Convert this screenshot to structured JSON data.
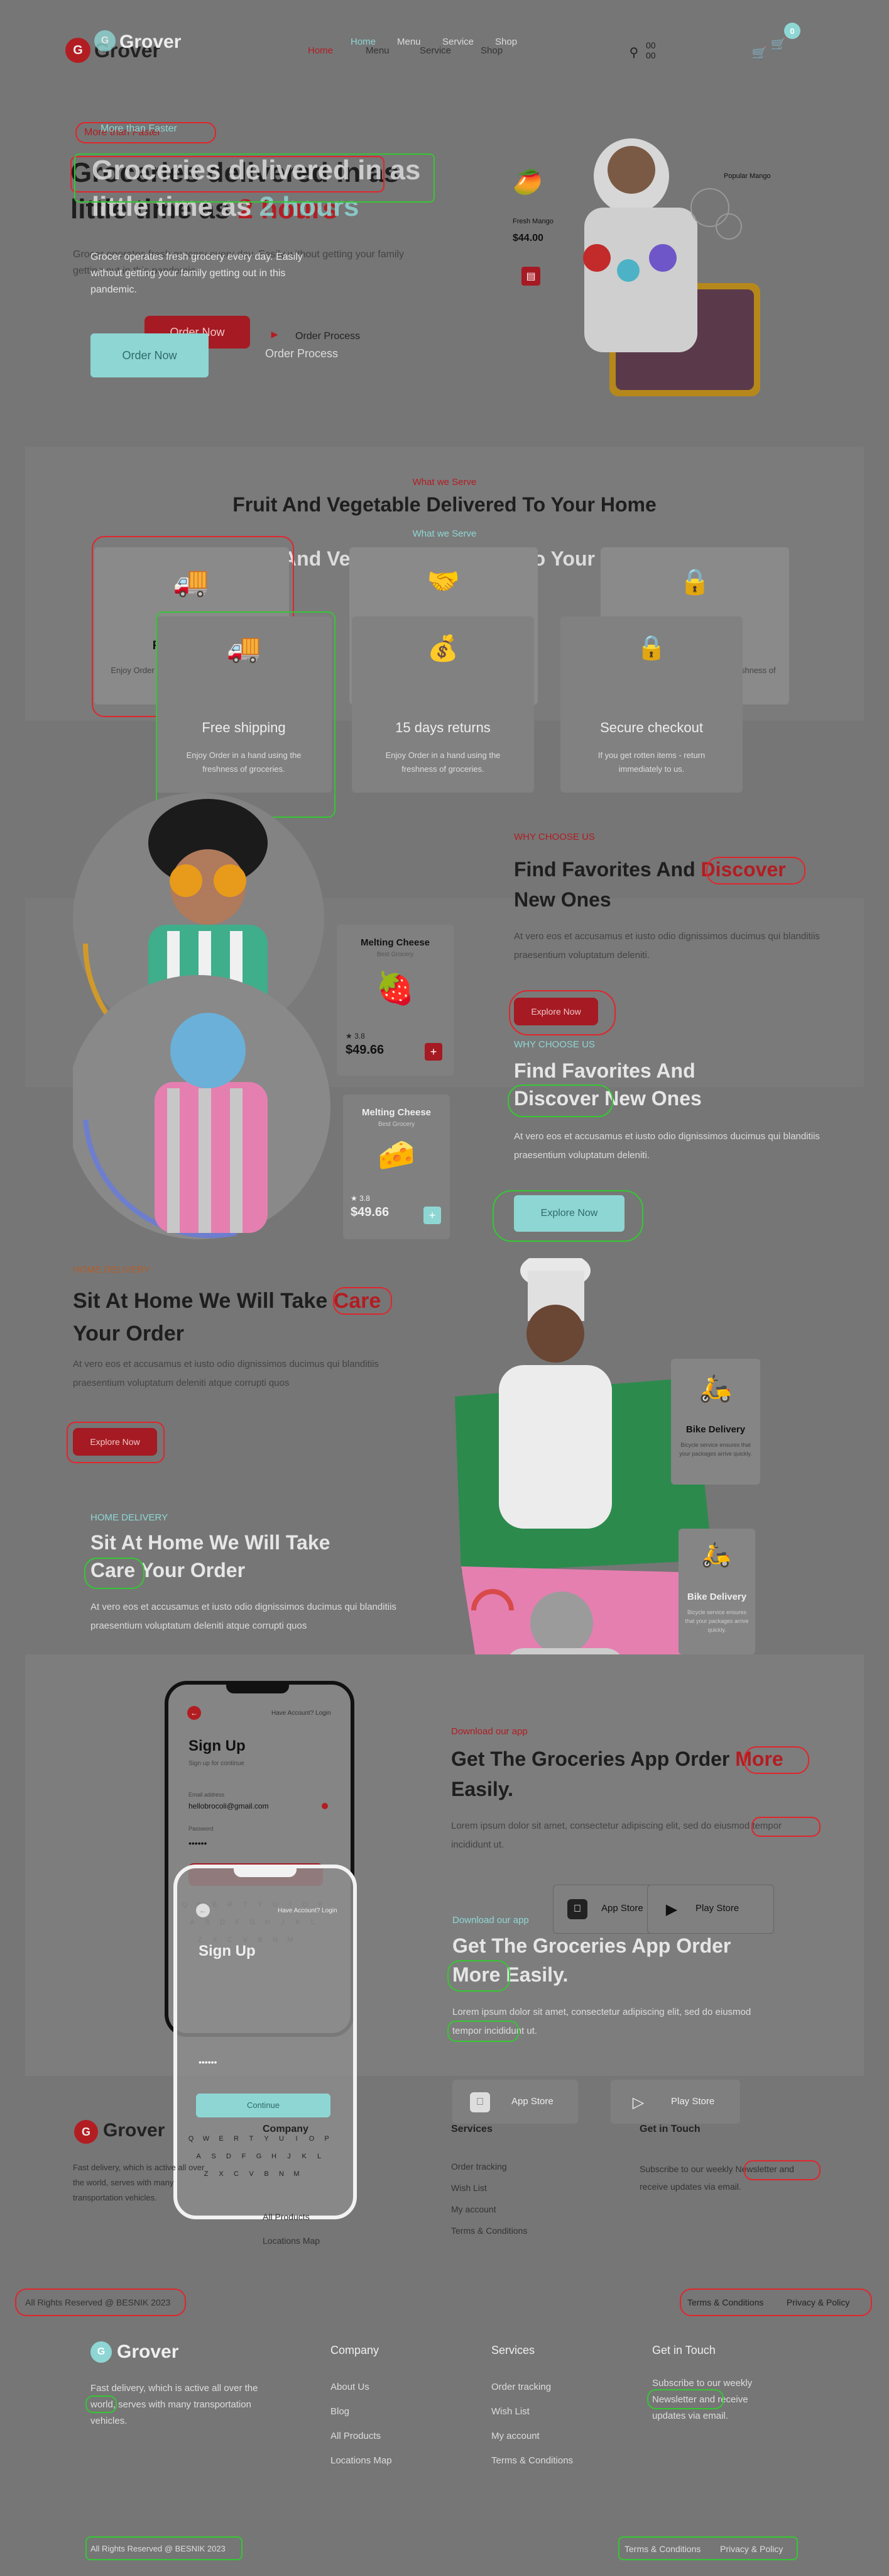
{
  "colors": {
    "red": "#b21d22",
    "teal": "#8ed6d3",
    "bg": "#767676"
  },
  "brand": {
    "name": "Grover",
    "icon": "g-letter-logo"
  },
  "nav": {
    "items": [
      "Home",
      "Menu",
      "Service",
      "Shop"
    ],
    "cart_count": "00",
    "search_count": "00",
    "badge": "0"
  },
  "hero": {
    "badge": "More than Faster",
    "title_line1": "Groceries delivered in as",
    "title_line2": "little time as",
    "title_hl": "2 hours",
    "desc": "Grocer operates fresh grocery every day. Easily without getting your family getting out in this pandemic.",
    "order_btn": "Order Now",
    "order_process": "Order Process",
    "product_name": "Fresh Mango",
    "product_price": "$44.00",
    "popular_label": "Popular Mango"
  },
  "serve": {
    "eyebrow": "What we Serve",
    "title": "Fruit And Vegetable Delivered To Your Home",
    "cards": [
      {
        "title": "Free shipping",
        "desc": "Enjoy Order in a hand using the freshness of groceries."
      },
      {
        "title": "15 days returns",
        "desc": "Enjoy Order in a hand using the freshness of groceries."
      },
      {
        "title": "Secure checkout",
        "desc": "If you get rotten items - return immediately to us."
      }
    ]
  },
  "why": {
    "eyebrow": "WHY CHOOSE US",
    "title_a": "Find Favorites And",
    "title_hl": "Discover",
    "title_b": "New Ones",
    "desc": "At vero eos et accusamus et iusto odio dignissimos ducimus qui blanditiis praesentium voluptatum deleniti.",
    "btn": "Explore Now",
    "cards": [
      {
        "name": "Melting Cheese",
        "sub": "Best Grocery",
        "rating": "3.8",
        "price": "$49.66"
      },
      {
        "name": "Melting Cheese",
        "sub": "Best Grocery",
        "rating": "3.8",
        "price": "$49.66"
      }
    ]
  },
  "home": {
    "eyebrow": "HOME DELIVERY",
    "title_a": "Sit At Home We Will Take",
    "title_hl": "Care",
    "title_b": "Your Order",
    "desc": "At vero eos et accusamus et iusto odio dignissimos ducimus qui blanditiis praesentium voluptatum deleniti atque corrupti quos",
    "btn": "Explore Now",
    "bike_title": "Bike Delivery",
    "bike_desc": "Bicycle service ensures that your packages arrive quickly."
  },
  "app": {
    "eyebrow": "Download our app",
    "title_a": "Get The Groceries App Order",
    "title_hl": "More",
    "title_b": "Easily.",
    "desc": "Lorem ipsum dolor sit amet, consectetur adipiscing elit, sed do eiusmod tempor incididunt ut.",
    "appstore": "App Store",
    "playstore": "Play Store",
    "phone": {
      "signup": "Sign Up",
      "sub": "Sign up for continue",
      "have": "Have Account? Login",
      "email_label": "Email address",
      "email": "hellobrocoli@gmail.com",
      "password_label": "Password",
      "password": "••••••",
      "continue": "Continue"
    }
  },
  "footer": {
    "about": "Fast delivery, which is active all over the world, serves with many transportation vehicles.",
    "company_title": "Company",
    "company": [
      "About Us",
      "Blog",
      "All Products",
      "Locations Map"
    ],
    "services_title": "Services",
    "services": [
      "Order tracking",
      "Wish List",
      "My account",
      "Terms & Conditions"
    ],
    "touch_title": "Get in Touch",
    "touch": "Subscribe to our weekly Newsletter and receive updates via email.",
    "rights": "All Rights Reserved @ BESNIK 2023",
    "terms": "Terms & Conditions",
    "privacy": "Privacy & Policy"
  }
}
